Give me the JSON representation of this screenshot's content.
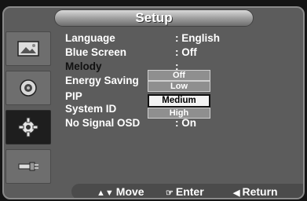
{
  "menu": {
    "title": "Setup"
  },
  "sidebar": {
    "items": [
      {
        "icon": "picture-icon",
        "active": false
      },
      {
        "icon": "sound-icon",
        "active": false
      },
      {
        "icon": "gear-icon",
        "active": true
      },
      {
        "icon": "input-icon",
        "active": false
      }
    ]
  },
  "settings": {
    "language": {
      "label": "Language",
      "value": ": English"
    },
    "blue_screen": {
      "label": "Blue Screen",
      "value": ": Off"
    },
    "melody": {
      "label": "Melody",
      "value": ":"
    },
    "energy_saving": {
      "label": "Energy Saving",
      "value": ":"
    },
    "pip": {
      "label": "PIP",
      "value": ""
    },
    "system_id": {
      "label": "System ID",
      "value": ":"
    },
    "no_signal_osd": {
      "label": "No Signal OSD",
      "value": ": On"
    }
  },
  "dropdown": {
    "options": [
      "Off",
      "Low",
      "Medium",
      "High"
    ],
    "selected": "Medium"
  },
  "footer": {
    "move": "Move",
    "enter": "Enter",
    "return": "Return"
  },
  "colors": {
    "panel": "#5c5c5c",
    "active_tab": "#1e1e1e",
    "highlight_text": "#111111"
  }
}
